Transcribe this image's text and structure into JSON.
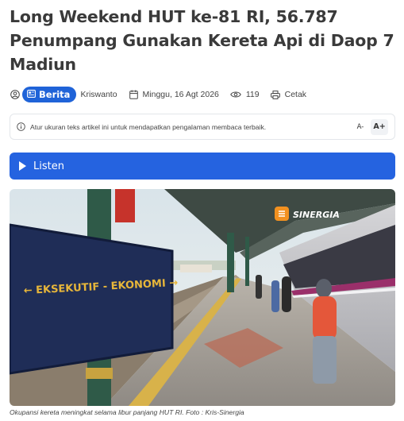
{
  "article": {
    "title": "Long Weekend HUT ke-81 RI, 56.787 Penumpang Gunakan Kereta Api di Daop 7 Madiun",
    "category": "Berita",
    "author": "Kriswanto",
    "date": "Minggu, 16 Agt 2026",
    "views": "119",
    "print_label": "Cetak"
  },
  "notice": {
    "text": "Atur ukuran teks artikel ini untuk mendapatkan pengalaman membaca terbaik.",
    "decrease_label": "A-",
    "increase_label": "A+"
  },
  "listen": {
    "label": "Listen"
  },
  "photo": {
    "sign_text": "← EKSEKUTIF - EKONOMI →",
    "watermark": "SINERGIA",
    "caption": "Okupansi kereta meningkat selama libur panjang HUT RI. Foto : Kris-Sinergia"
  },
  "icons": [
    "author-icon",
    "news-icon",
    "calendar-icon",
    "eye-icon",
    "printer-icon",
    "info-icon",
    "play-icon",
    "sinergia-logo-icon"
  ],
  "colors": {
    "accent": "#2563e0",
    "badge": "#1f63d8",
    "title": "#3a3a3a"
  }
}
